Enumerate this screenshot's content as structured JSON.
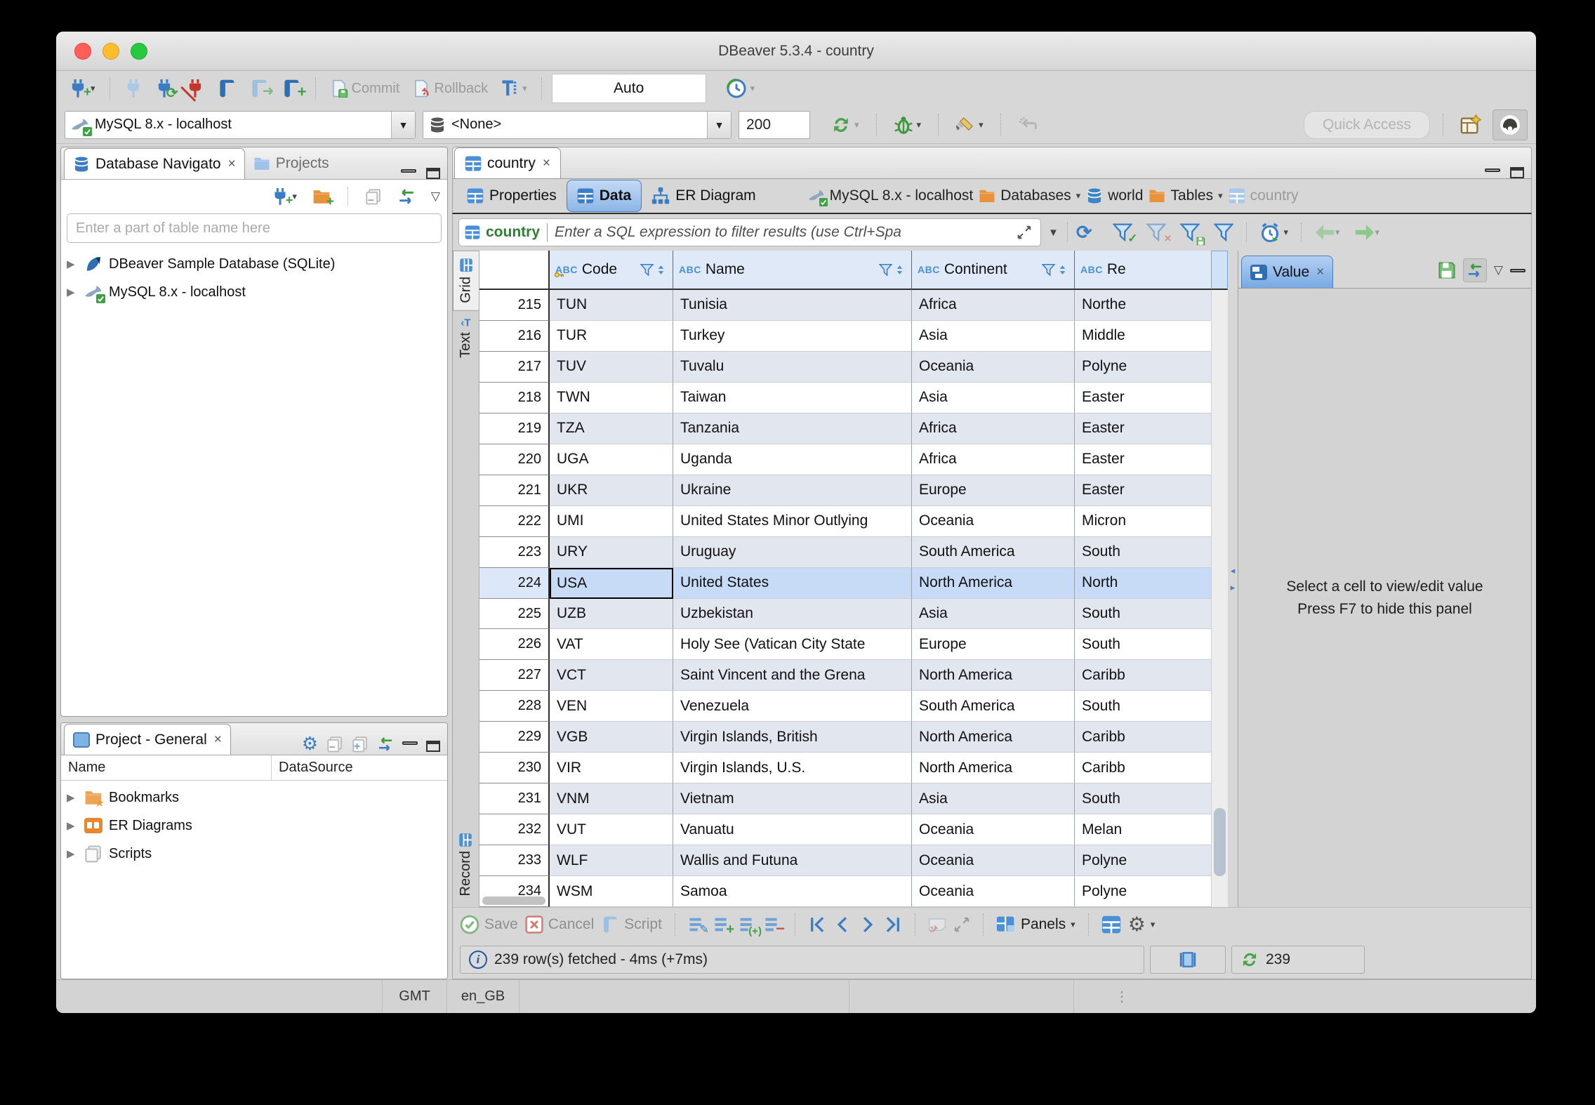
{
  "window": {
    "title": "DBeaver 5.3.4 - country"
  },
  "icons": {
    "dropdown": "▾",
    "dropdown_big": "▼",
    "close": "×",
    "refresh": "⟳",
    "gear": "⚙",
    "more": "⋮",
    "expander": "▶",
    "panel_menu": "▽",
    "split_left": "◂",
    "split_right": "▸",
    "info": "i"
  },
  "toolbar": {
    "commit_label": "Commit",
    "rollback_label": "Rollback",
    "auto_label": "Auto"
  },
  "connection_bar": {
    "connection": "MySQL 8.x - localhost",
    "database": "<None>",
    "fetch_size": "200",
    "quick_access_placeholder": "Quick Access"
  },
  "navigator": {
    "tab_database": "Database Navigato",
    "tab_projects": "Projects",
    "search_placeholder": "Enter a part of table name here",
    "items": [
      {
        "label": "DBeaver Sample Database (SQLite)"
      },
      {
        "label": "MySQL 8.x - localhost"
      }
    ]
  },
  "project_panel": {
    "title": "Project - General",
    "columns": {
      "name": "Name",
      "datasource": "DataSource"
    },
    "items": [
      {
        "label": "Bookmarks"
      },
      {
        "label": "ER Diagrams"
      },
      {
        "label": "Scripts"
      }
    ]
  },
  "editor": {
    "tab": "country",
    "subtabs": {
      "properties": "Properties",
      "data": "Data",
      "er": "ER Diagram"
    },
    "breadcrumb": [
      {
        "label": "MySQL 8.x - localhost"
      },
      {
        "label": "Databases"
      },
      {
        "label": "world"
      },
      {
        "label": "Tables"
      },
      {
        "label": "country"
      }
    ]
  },
  "filter": {
    "table": "country",
    "placeholder": "Enter a SQL expression to filter results (use Ctrl+Spa"
  },
  "grid": {
    "side_tabs": {
      "grid": "Grid",
      "text": "Text",
      "record": "Record"
    },
    "type_badge": "ABC",
    "columns": {
      "code": "Code",
      "name": "Name",
      "continent": "Continent",
      "region": "Re"
    },
    "selected_row": 224,
    "rows": [
      [
        215,
        "TUN",
        "Tunisia",
        "Africa",
        "Northe"
      ],
      [
        216,
        "TUR",
        "Turkey",
        "Asia",
        "Middle"
      ],
      [
        217,
        "TUV",
        "Tuvalu",
        "Oceania",
        "Polyne"
      ],
      [
        218,
        "TWN",
        "Taiwan",
        "Asia",
        "Easter"
      ],
      [
        219,
        "TZA",
        "Tanzania",
        "Africa",
        "Easter"
      ],
      [
        220,
        "UGA",
        "Uganda",
        "Africa",
        "Easter"
      ],
      [
        221,
        "UKR",
        "Ukraine",
        "Europe",
        "Easter"
      ],
      [
        222,
        "UMI",
        "United States Minor Outlying",
        "Oceania",
        "Micron"
      ],
      [
        223,
        "URY",
        "Uruguay",
        "South America",
        "South"
      ],
      [
        224,
        "USA",
        "United States",
        "North America",
        "North"
      ],
      [
        225,
        "UZB",
        "Uzbekistan",
        "Asia",
        "South"
      ],
      [
        226,
        "VAT",
        "Holy See (Vatican City State",
        "Europe",
        "South"
      ],
      [
        227,
        "VCT",
        "Saint Vincent and the Grena",
        "North America",
        "Caribb"
      ],
      [
        228,
        "VEN",
        "Venezuela",
        "South America",
        "South"
      ],
      [
        229,
        "VGB",
        "Virgin Islands, British",
        "North America",
        "Caribb"
      ],
      [
        230,
        "VIR",
        "Virgin Islands, U.S.",
        "North America",
        "Caribb"
      ],
      [
        231,
        "VNM",
        "Vietnam",
        "Asia",
        "South"
      ],
      [
        232,
        "VUT",
        "Vanuatu",
        "Oceania",
        "Melan"
      ],
      [
        233,
        "WLF",
        "Wallis and Futuna",
        "Oceania",
        "Polyne"
      ],
      [
        234,
        "WSM",
        "Samoa",
        "Oceania",
        "Polyne"
      ]
    ]
  },
  "value_panel": {
    "tab": "Value",
    "message_line1": "Select a cell to view/edit value",
    "message_line2": "Press F7 to hide this panel"
  },
  "result_toolbar": {
    "save_label": "Save",
    "cancel_label": "Cancel",
    "script_label": "Script",
    "panels_label": "Panels"
  },
  "status": {
    "fetch_message": "239 row(s) fetched - 4ms (+7ms)",
    "row_count": "239"
  },
  "os_bar": {
    "timezone": "GMT",
    "locale": "en_GB"
  }
}
